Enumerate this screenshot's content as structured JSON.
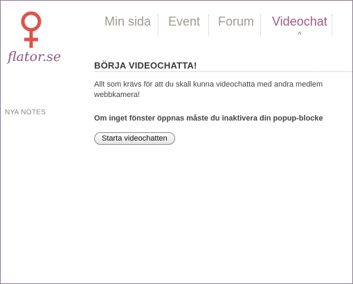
{
  "logo": {
    "text": "flator.se",
    "icon": "venus-symbol-icon",
    "icon_color": "#e0524a"
  },
  "nav": {
    "items": [
      {
        "label": "Min sida",
        "active": false
      },
      {
        "label": "Event",
        "active": false
      },
      {
        "label": "Forum",
        "active": false
      },
      {
        "label": "Videochat",
        "active": true
      }
    ],
    "active_indicator": "^"
  },
  "sidebar": {
    "nya_notes_label": "NYA NOTES"
  },
  "main": {
    "heading": "BÖRJA VIDEOCHATTA!",
    "intro_line1": "Allt som krävs för att du skall kunna videochatta med andra medlem",
    "intro_line2": "webbkamera!",
    "popup_warning": "Om inget fönster öppnas måste du inaktivera din popup-blocke",
    "start_button_label": "Starta videochatten"
  },
  "colors": {
    "accent": "#a05a80",
    "nav_inactive": "#a09a92",
    "logo_red": "#e0524a",
    "frame_border": "#8e7d94"
  }
}
